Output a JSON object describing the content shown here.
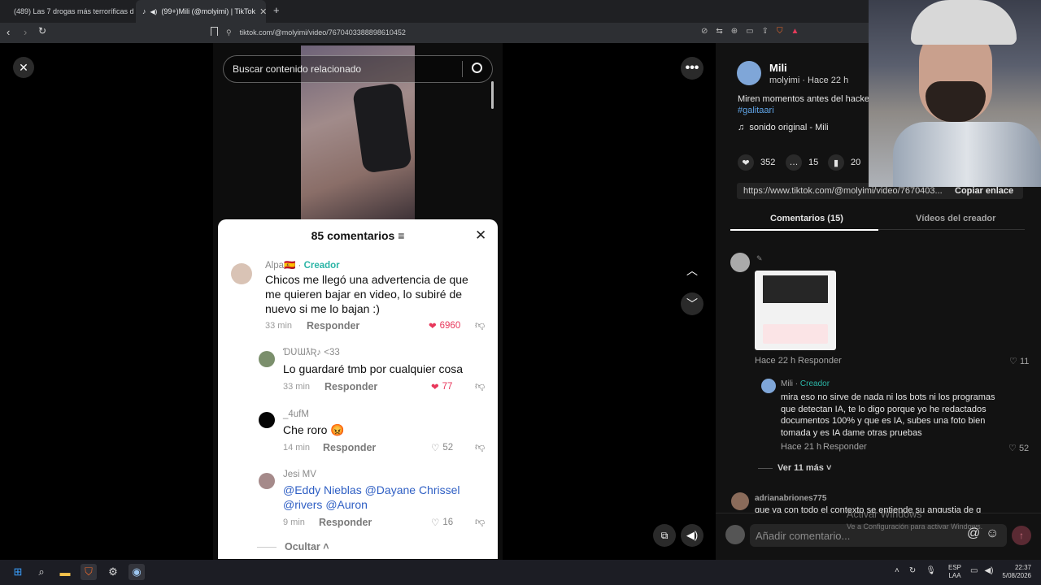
{
  "browser": {
    "tabs": [
      {
        "label": "(489) Las 7 drogas más terroríficas de"
      },
      {
        "label": "(99+)Mili (@molyimi) | TikTok"
      }
    ],
    "new_tab": "+",
    "url": "tiktok.com/@molyimi/video/7670403388898610452"
  },
  "video": {
    "search_placeholder": "Buscar contenido relacionado",
    "comments_sheet": {
      "title": "85 comentarios",
      "comments": [
        {
          "user": "Alpa🇪🇸 · ",
          "creator": "Creador",
          "text": "Chicos me llegó una advertencia de que me quieren bajar en video, lo subiré de nuevo si me lo bajan :)",
          "time": "33 min",
          "reply": "Responder",
          "likes": "6960",
          "liked": true
        },
        {
          "user": "ƊƲƜƛƦ♪ <33",
          "text": "Lo guardaré tmb por cualquier cosa",
          "time": "33 min",
          "reply": "Responder",
          "likes": "77",
          "liked": true
        },
        {
          "user": "_4ufM",
          "text": "Che roro 😡",
          "time": "14 min",
          "reply": "Responder",
          "likes": "52",
          "liked": false
        },
        {
          "user": "Jesi MV",
          "text": "@Eddy Nieblas @Dayane Chrissel @rivers @Auron",
          "time": "9 min",
          "reply": "Responder",
          "likes": "16",
          "liked": false
        }
      ],
      "hide_label": "Ocultar"
    }
  },
  "panel": {
    "author_name": "Mili",
    "author_meta": "molyimi · Hace 22 h",
    "caption": "Miren momentos antes del hackeo",
    "hashtag": "#galitaari",
    "sound": "sonido original - Mili",
    "stats": {
      "likes": "352",
      "comments": "15",
      "saves": "20"
    },
    "link": "https://www.tiktok.com/@molyimi/video/7670403...",
    "copy_link": "Copiar enlace",
    "tabs": [
      "Comentarios (15)",
      "Vídeos del creador"
    ],
    "comment1": {
      "time": "Hace 22 h",
      "reply": "Responder",
      "likes": "11"
    },
    "reply1": {
      "user": "Mili",
      "creator": "Creador",
      "text": "mira eso no sirve de nada ni los bots ni los programas que detectan IA, te lo digo porque yo he redactados documentos 100% y que es IA, subes una foto bien tomada y es IA dame otras pruebas",
      "time": "Hace 21 h",
      "reply": "Responder",
      "likes": "52"
    },
    "more_replies": "Ver 11 más",
    "comment2": {
      "user": "adrianabriones775",
      "text": "que va con todo el contexto se entiende su angustia de q"
    },
    "add_comment_placeholder": "Añadir comentario...",
    "watermark1": "Activar Windows",
    "watermark2": "Ve a Configuración para activar Windows."
  },
  "taskbar": {
    "lang1": "ESP",
    "lang2": "LAA",
    "time": "22:37",
    "date": "5/08/2026"
  }
}
